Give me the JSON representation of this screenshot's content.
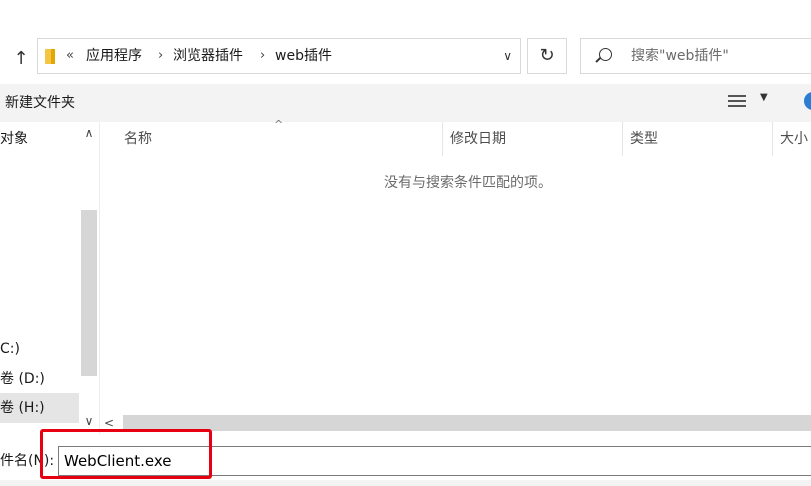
{
  "address_bar": {
    "overflow": "«",
    "crumbs": [
      "应用程序",
      "浏览器插件",
      "web插件"
    ],
    "separator": "›",
    "dropdown": "∨"
  },
  "refresh_glyph": "↻",
  "up_glyph": "↑",
  "search": {
    "placeholder": "搜索\"web插件\""
  },
  "toolbar": {
    "new_folder": "新建文件夹"
  },
  "nav": {
    "items": [
      "对象",
      "C:)",
      "卷 (D:)",
      "卷 (H:)"
    ],
    "selected_index": 3,
    "scroll_up": "∧",
    "scroll_down": "∨"
  },
  "columns": [
    "名称",
    "修改日期",
    "类型",
    "大小"
  ],
  "sort_caret": "^",
  "empty_message": "没有与搜索条件匹配的项。",
  "hscroll_left": "<",
  "filename": {
    "label": "件名(N):",
    "value": "WebClient.exe"
  },
  "colors": {
    "highlight_box": "#e60012",
    "folder": "#f4c542",
    "help": "#2b7cd3"
  },
  "icons": [
    "up-arrow-icon",
    "folder-icon",
    "refresh-icon",
    "search-icon",
    "view-options-icon",
    "help-icon"
  ]
}
